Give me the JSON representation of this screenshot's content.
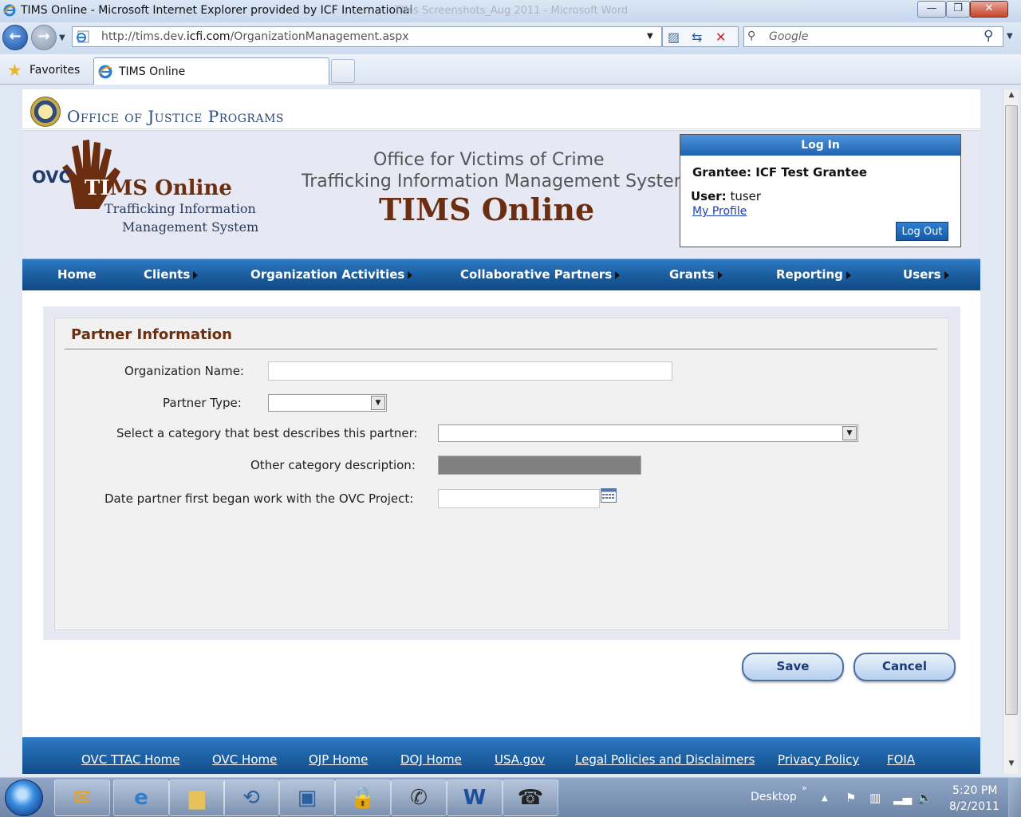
{
  "window": {
    "title": "TIMS Online - Microsoft Internet Explorer provided by ICF International",
    "ghost_title": "TIMs Screenshots_Aug 2011 - Microsoft Word",
    "min_label": "—",
    "max_label": "❐",
    "close_label": "✕"
  },
  "browser": {
    "url_prefix": "http://tims.dev.",
    "url_domain": "icfi.com",
    "url_path": "/OrganizationManagement.aspx",
    "search_placeholder": "Google",
    "favorites_label": "Favorites",
    "tab_label": "TIMS Online"
  },
  "header": {
    "ojp_title": "Office of Justice Programs",
    "logo_ovc": "OVC",
    "logo_title_1": "TI",
    "logo_title_2": "MS Online",
    "logo_sub_1": "Trafficking Information",
    "logo_sub_2": "Management System",
    "center_line_1": "Office for Victims of Crime",
    "center_line_2": "Trafficking Information Management System",
    "center_line_3": "TIMS Online"
  },
  "login": {
    "header": "Log In",
    "grantee": "Grantee: ICF Test Grantee",
    "user_label": "User:",
    "user_value": " tuser",
    "profile_link": "My Profile",
    "logout_button": "Log Out"
  },
  "menu": {
    "items": [
      {
        "label": "Home",
        "has_submenu": false
      },
      {
        "label": "Clients",
        "has_submenu": true
      },
      {
        "label": "Organization Activities",
        "has_submenu": true
      },
      {
        "label": "Collaborative Partners",
        "has_submenu": true
      },
      {
        "label": "Grants",
        "has_submenu": true
      },
      {
        "label": "Reporting",
        "has_submenu": true
      },
      {
        "label": "Users",
        "has_submenu": true
      }
    ]
  },
  "form": {
    "section_title": "Partner Information",
    "org_name_label": "Organization Name:",
    "org_name_value": "",
    "partner_type_label": "Partner Type:",
    "partner_type_value": "",
    "category_label": "Select a category that best describes this partner:",
    "category_value": "",
    "other_desc_label": "Other category description:",
    "date_label": "Date partner first began work with the OVC Project:",
    "date_value": "",
    "save_button": "Save",
    "cancel_button": "Cancel"
  },
  "footer": {
    "links": [
      "OVC TTAC Home",
      "OVC Home",
      "OJP Home",
      "DOJ Home",
      "USA.gov",
      "Legal Policies and Disclaimers",
      "Privacy Policy",
      "FOIA"
    ]
  },
  "taskbar": {
    "desktop_label": "Desktop",
    "time": "5:20 PM",
    "date": "8/2/2011",
    "apps": [
      "outlook-icon",
      "internet-explorer-icon",
      "folder-icon",
      "remote-app-icon",
      "virtual-pc-icon",
      "network-lock-icon",
      "phone-icon",
      "word-icon",
      "fax-icon"
    ]
  },
  "colors": {
    "menu_blue": "#1a5c9d",
    "title_brown": "#6b2e10",
    "banner_bg": "#e6e8f3",
    "link_blue": "#1d3fb5"
  }
}
